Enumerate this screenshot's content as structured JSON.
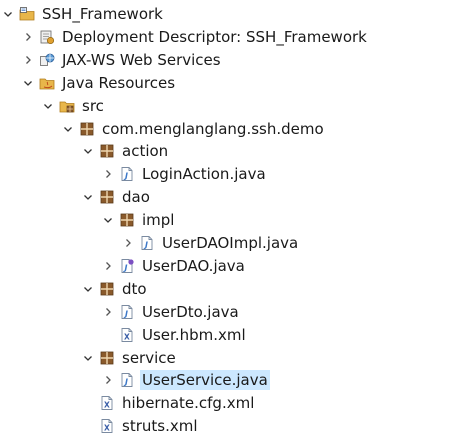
{
  "tree": {
    "items": [
      {
        "id": "project",
        "label": "SSH_Framework",
        "icon": "project",
        "depth": 0,
        "expanded": true
      },
      {
        "id": "deployment-descriptor",
        "label": "Deployment Descriptor: SSH_Framework",
        "icon": "deployment-descriptor",
        "depth": 1,
        "expanded": false
      },
      {
        "id": "jax-ws",
        "label": "JAX-WS Web Services",
        "icon": "web-services",
        "depth": 1,
        "expanded": false
      },
      {
        "id": "java-resources",
        "label": "Java Resources",
        "icon": "java-resources",
        "depth": 1,
        "expanded": true
      },
      {
        "id": "src",
        "label": "src",
        "icon": "source-folder",
        "depth": 2,
        "expanded": true
      },
      {
        "id": "pkg-demo",
        "label": "com.menglanglang.ssh.demo",
        "icon": "package",
        "depth": 3,
        "expanded": true
      },
      {
        "id": "pkg-action",
        "label": "action",
        "icon": "package",
        "depth": 4,
        "expanded": true
      },
      {
        "id": "login-action",
        "label": "LoginAction.java",
        "icon": "java-file",
        "depth": 5,
        "expanded": false
      },
      {
        "id": "pkg-dao",
        "label": "dao",
        "icon": "package",
        "depth": 4,
        "expanded": true
      },
      {
        "id": "pkg-impl",
        "label": "impl",
        "icon": "package",
        "depth": 5,
        "expanded": true
      },
      {
        "id": "user-dao-impl",
        "label": "UserDAOImpl.java",
        "icon": "java-file",
        "depth": 6,
        "expanded": false
      },
      {
        "id": "user-dao",
        "label": "UserDAO.java",
        "icon": "java-interface-file",
        "depth": 5,
        "expanded": false
      },
      {
        "id": "pkg-dto",
        "label": "dto",
        "icon": "package",
        "depth": 4,
        "expanded": true
      },
      {
        "id": "user-dto",
        "label": "UserDto.java",
        "icon": "java-file",
        "depth": 5,
        "expanded": false
      },
      {
        "id": "user-hbm",
        "label": "User.hbm.xml",
        "icon": "xml-file",
        "depth": 5,
        "expanded": null
      },
      {
        "id": "pkg-service",
        "label": "service",
        "icon": "package",
        "depth": 4,
        "expanded": true
      },
      {
        "id": "user-service",
        "label": "UserService.java",
        "icon": "java-file",
        "depth": 5,
        "expanded": false,
        "selected": true
      },
      {
        "id": "hibernate-cfg",
        "label": "hibernate.cfg.xml",
        "icon": "xml-file",
        "depth": 4,
        "expanded": null
      },
      {
        "id": "struts",
        "label": "struts.xml",
        "icon": "xml-file",
        "depth": 4,
        "expanded": null
      }
    ]
  },
  "colors": {
    "selection": "#cce8ff",
    "package": "#8a5a2b",
    "folder": "#e8b64a",
    "java": "#3c78c8",
    "xml": "#3b5fa8",
    "interface": "#7b4fc2"
  }
}
